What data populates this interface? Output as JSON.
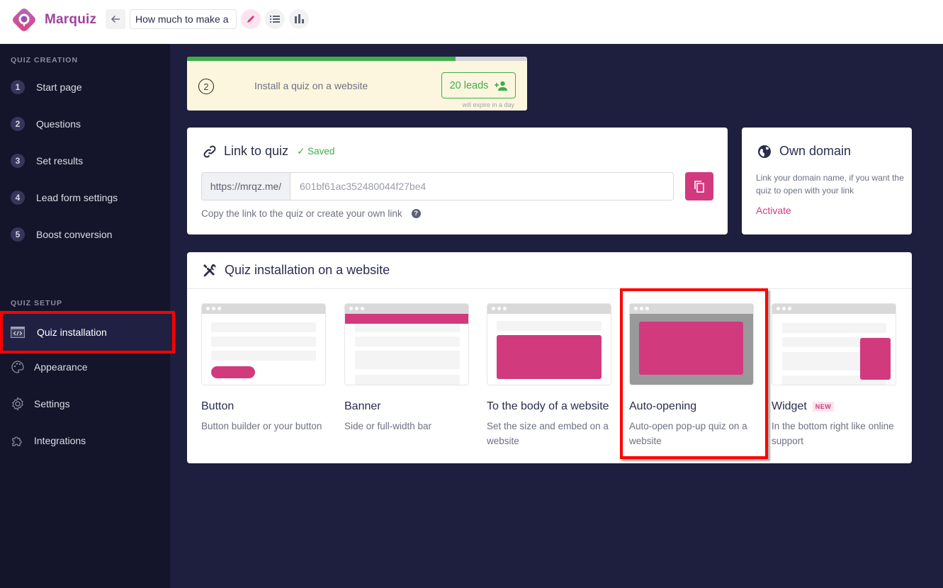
{
  "app": {
    "brand": "Marquiz",
    "quiz_title_value": "How much to make a",
    "brand_color": "#a0429e",
    "accent_color": "#d23a7e",
    "success_color": "#3ead4b"
  },
  "toolbar": {
    "back_icon": "arrow-left-icon",
    "edit_icon": "pencil-icon",
    "list_icon": "list-icon",
    "stats_icon": "bar-chart-icon"
  },
  "sidebar": {
    "creation_title": "QUIZ CREATION",
    "creation_items": [
      {
        "num": "1",
        "label": "Start page"
      },
      {
        "num": "2",
        "label": "Questions"
      },
      {
        "num": "3",
        "label": "Set results"
      },
      {
        "num": "4",
        "label": "Lead form settings"
      },
      {
        "num": "5",
        "label": "Boost conversion"
      }
    ],
    "setup_title": "QUIZ SETUP",
    "setup_items": [
      {
        "label": "Quiz installation",
        "icon": "code-window-icon",
        "active": true
      },
      {
        "label": "Appearance",
        "icon": "palette-icon"
      },
      {
        "label": "Settings",
        "icon": "gear-icon"
      },
      {
        "label": "Integrations",
        "icon": "puzzle-icon"
      }
    ]
  },
  "progress": {
    "step": "2",
    "text": "Install a quiz on a website",
    "fill_percent": 79,
    "leads_label": "20 leads",
    "leads_icon": "add-person-icon",
    "expire_text": "will expire in a day"
  },
  "link_card": {
    "title": "Link to quiz",
    "saved_label": "✓ Saved",
    "url_prefix": "https://mrqz.me/",
    "url_value": "601bf61ac352480044f27be4",
    "hint": "Copy the link to the quiz or create your own link",
    "help_glyph": "?",
    "copy_icon": "copy-icon"
  },
  "domain_card": {
    "title": "Own domain",
    "description": "Link your domain name, if you want the quiz to open with your link",
    "action": "Activate"
  },
  "install_card": {
    "title": "Quiz installation on a website",
    "options": [
      {
        "title": "Button",
        "desc": "Button builder or your button"
      },
      {
        "title": "Banner",
        "desc": "Side or full-width bar"
      },
      {
        "title": "To the body of a website",
        "desc": "Set the size and embed on a website"
      },
      {
        "title": "Auto-opening",
        "desc": "Auto-open pop-up quiz on a website",
        "highlighted": true
      },
      {
        "title": "Widget",
        "desc": "In the bottom right like online support",
        "badge": "NEW"
      }
    ]
  }
}
